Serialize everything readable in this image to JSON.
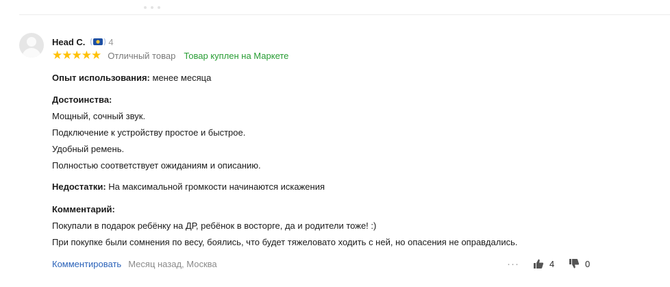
{
  "review": {
    "author": "Head C.",
    "badge_count": "4",
    "rating_stars": 5,
    "rating_text": "Отличный товар",
    "purchased": "Товар куплен на Маркете",
    "experience_label": "Опыт использования:",
    "experience_value": "менее месяца",
    "pros_label": "Достоинства:",
    "pros": [
      "Мощный, сочный звук.",
      "Подключение к устройству простое и быстрое.",
      "Удобный ремень.",
      "Полностью соответствует ожиданиям и описанию."
    ],
    "cons_label": "Недостатки:",
    "cons_value": "На максимальной громкости начинаются искажения",
    "comment_label": "Комментарий:",
    "comment": [
      "Покупали в подарок ребёнку на ДР, ребёнок в восторге, да и родители тоже! :)",
      "При покупке были сомнения по весу, боялись, что будет тяжеловато ходить с ней, но опасения не оправдались."
    ],
    "footer": {
      "comment_link": "Комментировать",
      "meta": "Месяц назад, Москва",
      "more": "···",
      "likes": "4",
      "dislikes": "0"
    }
  },
  "colors": {
    "star": "#ffc107",
    "purchased": "#289d34",
    "link": "#2a62b9",
    "badge_blue": "#1d4fa3"
  },
  "icons": [
    "avatar-placeholder",
    "star-icon",
    "reviewer-badge-icon",
    "more-icon",
    "thumb-up-icon",
    "thumb-down-icon"
  ]
}
